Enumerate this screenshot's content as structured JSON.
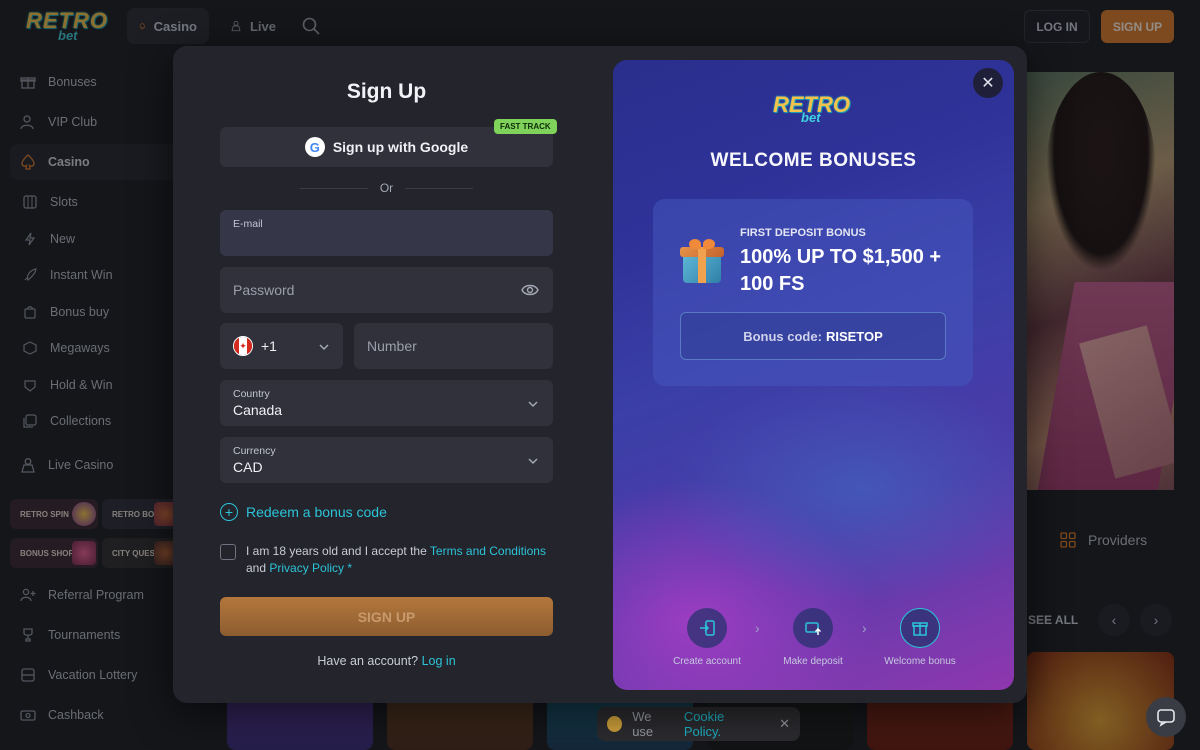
{
  "topbar": {
    "logo_main": "RETRO",
    "logo_sub": "bet",
    "nav_casino": "Casino",
    "nav_live": "Live",
    "login_label": "LOG IN",
    "signup_label": "SIGN UP"
  },
  "sidebar": {
    "items": [
      {
        "label": "Bonuses",
        "icon": "gift-icon"
      },
      {
        "label": "VIP Club",
        "icon": "user-star-icon"
      },
      {
        "label": "Casino",
        "icon": "spade-icon"
      },
      {
        "label": "Slots",
        "icon": "slot-icon"
      },
      {
        "label": "New",
        "icon": "lightning-icon"
      },
      {
        "label": "Instant Win",
        "icon": "rocket-icon"
      },
      {
        "label": "Bonus buy",
        "icon": "bag-icon"
      },
      {
        "label": "Megaways",
        "icon": "grid-icon"
      },
      {
        "label": "Hold & Win",
        "icon": "coins-icon"
      },
      {
        "label": "Collections",
        "icon": "layers-icon"
      },
      {
        "label": "Live Casino",
        "icon": "dealer-icon"
      },
      {
        "label": "Referral Program",
        "icon": "referral-icon"
      },
      {
        "label": "Tournaments",
        "icon": "trophy-icon"
      },
      {
        "label": "Vacation Lottery",
        "icon": "ticket-icon"
      },
      {
        "label": "Cashback",
        "icon": "cashback-icon"
      }
    ],
    "promo_tiles": [
      "RETRO SPIN",
      "RETRO BOX",
      "BONUS SHOP",
      "CITY QUEST"
    ]
  },
  "background": {
    "providers_label": "Providers",
    "see_all_label": "SEE ALL",
    "cookie_text": "We use",
    "cookie_policy": "Cookie Policy."
  },
  "signup": {
    "title": "Sign Up",
    "google_label": "Sign up with Google",
    "fast_track": "FAST TRACK",
    "or_label": "Or",
    "email_label": "E-mail",
    "email_value": "",
    "password_placeholder": "Password",
    "phone_code": "+1",
    "phone_placeholder": "Number",
    "country_label": "Country",
    "country_value": "Canada",
    "currency_label": "Currency",
    "currency_value": "CAD",
    "redeem_label": "Redeem a bonus code",
    "terms_prefix": "I am 18 years old and I accept the",
    "terms_link": "Terms and Conditions",
    "terms_and": "and",
    "privacy_link": "Privacy Policy",
    "submit_label": "SIGN UP",
    "have_account": "Have an account?",
    "login_link": "Log in"
  },
  "promo": {
    "logo_main": "RETRO",
    "logo_sub": "bet",
    "heading": "WELCOME BONUSES",
    "bonus_label": "FIRST DEPOSIT BONUS",
    "bonus_amount": "100% UP TO $1,500 + 100 FS",
    "code_prefix": "Bonus code:",
    "code_value": "RISETOP",
    "steps": [
      {
        "label": "Create account",
        "icon": "login-icon"
      },
      {
        "label": "Make deposit",
        "icon": "deposit-icon"
      },
      {
        "label": "Welcome bonus",
        "icon": "gift-icon"
      }
    ]
  },
  "colors": {
    "accent": "#2cc4d8",
    "brand_orange": "#d9782b",
    "fast_track": "#7fd35a"
  }
}
